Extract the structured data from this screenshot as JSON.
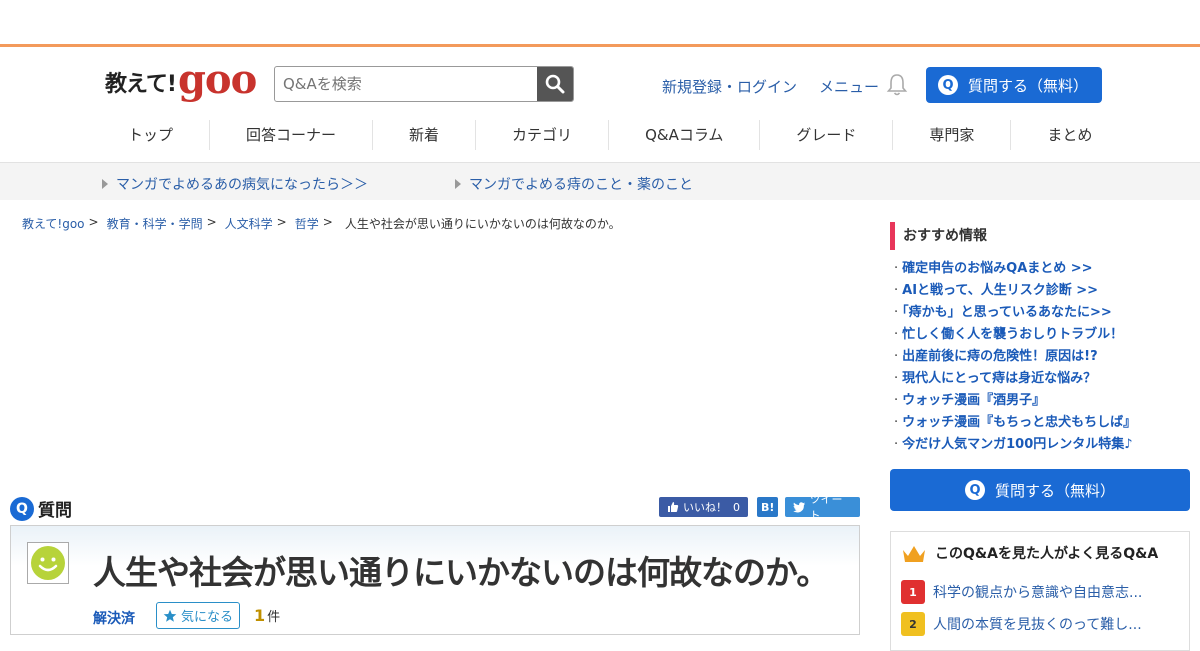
{
  "header": {
    "logo_jp": "教えて!",
    "logo_goo": "goo",
    "search_placeholder": "Q&Aを検索",
    "login_link": "新規登録・ログイン",
    "menu_link": "メニュー",
    "ask_button": "質問する（無料）"
  },
  "nav": [
    {
      "label": "トップ"
    },
    {
      "label": "回答コーナー"
    },
    {
      "label": "新着"
    },
    {
      "label": "カテゴリ"
    },
    {
      "label": "Q&Aコラム"
    },
    {
      "label": "グレード"
    },
    {
      "label": "専門家"
    },
    {
      "label": "まとめ"
    }
  ],
  "subnav": [
    {
      "label": "マンガでよめるあの病気になったら＞＞"
    },
    {
      "label": "マンガでよめる痔のこと・薬のこと"
    }
  ],
  "breadcrumb": [
    {
      "label": "教えて!goo"
    },
    {
      "label": "教育・科学・学問"
    },
    {
      "label": "人文科学"
    },
    {
      "label": "哲学"
    }
  ],
  "breadcrumb_current": "人生や社会が思い通りにいかないのは何故なのか。",
  "sidebar": {
    "rec_title": "おすすめ情報",
    "rec_items": [
      {
        "label": "確定申告のお悩みQAまとめ >>"
      },
      {
        "label": "AIと戦って、人生リスク診断 >>"
      },
      {
        "label": "「痔かも」と思っているあなたに>>"
      },
      {
        "label": "忙しく働く人を襲うおしりトラブル！"
      },
      {
        "label": "出産前後に痔の危険性！原因は!?"
      },
      {
        "label": "現代人にとって痔は身近な悩み？"
      },
      {
        "label": "ウォッチ漫画『酒男子』"
      },
      {
        "label": "ウォッチ漫画『もちっと忠犬もちしば』"
      },
      {
        "label": "今だけ人気マンガ100円レンタル特集♪"
      }
    ],
    "ask_button": "質問する（無料）",
    "also_title": "このQ&Aを見た人がよく見るQ&A",
    "also_items": [
      {
        "rank": "1",
        "label": "科学の観点から意識や自由意志..."
      },
      {
        "rank": "2",
        "label": "人間の本質を見抜くのって難し..."
      }
    ]
  },
  "question": {
    "section_label": "質問",
    "q_mark": "Q",
    "title": "人生や社会が思い通りにいかないのは何故なのか。",
    "status": "解決済",
    "watch_label": "気になる",
    "answer_count": "1",
    "answer_unit": "件"
  },
  "share": {
    "like_label": "いいね！",
    "like_count": "0",
    "hatena": "B!",
    "tweet": "ツイート"
  },
  "colors": {
    "accent": "#1a6ad4",
    "top_border": "#f39a5b",
    "rec_bar": "#e8365a",
    "link": "#2a5ea8"
  }
}
